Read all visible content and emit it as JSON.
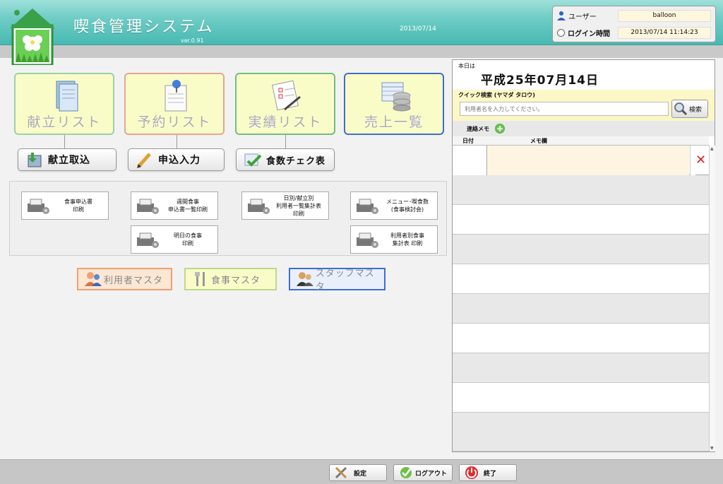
{
  "header": {
    "app_title": "喫食管理システム",
    "version": "ver.0.91",
    "date": "2013/07/14"
  },
  "session": {
    "user_label": "ユーザー",
    "user_value": "balloon",
    "login_label": "ログイン時間",
    "login_value": "2013/07/14 11:14:23"
  },
  "main_buttons": [
    {
      "label": "献立リスト",
      "icon": "document-icon"
    },
    {
      "label": "予約リスト",
      "icon": "pinned-note-icon"
    },
    {
      "label": "実績リスト",
      "icon": "checklist-icon"
    },
    {
      "label": "売上一覧",
      "icon": "database-icon"
    }
  ],
  "sub_buttons": [
    {
      "label": "献立取込",
      "icon": "import-icon"
    },
    {
      "label": "申込入力",
      "icon": "pencil-icon"
    },
    {
      "label": "食数チェク表",
      "icon": "check-icon"
    }
  ],
  "print_buttons": [
    {
      "label": "食事申込書\n印刷"
    },
    {
      "label": "週間食事\n申込書一覧印刷"
    },
    {
      "label": "日別/献立別\n利用者一覧集計表\n印刷"
    },
    {
      "label": "メニュー･喫食数\n(食事検討会)"
    },
    {
      "label": "明日の食事\n印刷"
    },
    {
      "label": "利用者別食事\n集計表 印刷"
    }
  ],
  "master_buttons": [
    {
      "label": "利用者マスタ",
      "icon": "users-icon"
    },
    {
      "label": "食事マスタ",
      "icon": "cutlery-icon"
    },
    {
      "label": "スタッフマスタ",
      "icon": "staff-icon"
    }
  ],
  "right_panel": {
    "today_label": "本日は",
    "today_date": "平成25年07月14日",
    "quick_search_label": "クイック検索 (ヤマダ タロウ)",
    "quick_search_placeholder": "利用者名を入力してください。",
    "search_button": "検索",
    "memo_header": "連絡メモ",
    "col_date": "日付",
    "col_memo": "メモ欄"
  },
  "footer": {
    "settings": "設定",
    "logout": "ログアウト",
    "exit": "終了"
  },
  "colors": {
    "header": "#6fcdc6",
    "button_fill": "#fafcc8",
    "memo_highlight": "#fdf4e2",
    "search_area": "#fbf7c6"
  }
}
